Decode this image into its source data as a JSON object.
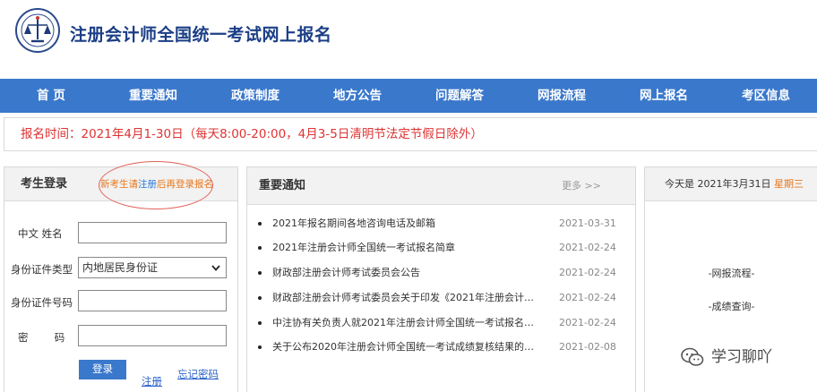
{
  "header": {
    "title": "注册会计师全国统一考试网上报名"
  },
  "nav": {
    "items": [
      "首 页",
      "重要通知",
      "政策制度",
      "地方公告",
      "问题解答",
      "网报流程",
      "网上报名",
      "考区信息"
    ]
  },
  "notice_bar": {
    "text": "报名时间：2021年4月1-30日（每天8:00-20:00，4月3-5日清明节法定节假日除外）"
  },
  "login": {
    "title": "考生登录",
    "hint_prefix": "新考生请",
    "hint_link": "注册",
    "hint_suffix": "后再登录报名",
    "labels": {
      "name": "中文  姓名",
      "id_type": "身份证件类型",
      "id_number": "身份证件号码",
      "password": "密        码"
    },
    "name_value": "",
    "id_type_value": "内地居民身份证",
    "id_number_value": "",
    "password_value": "",
    "login_button": "登录",
    "register_link": "注册",
    "forgot_link": "忘记密码"
  },
  "notices": {
    "title": "重要通知",
    "more": "更多 >>",
    "items": [
      {
        "title": "2021年报名期间各地咨询电话及邮箱",
        "date": "2021-03-31"
      },
      {
        "title": "2021年注册会计师全国统一考试报名简章",
        "date": "2021-02-24"
      },
      {
        "title": "财政部注册会计师考试委员会公告",
        "date": "2021-02-24"
      },
      {
        "title": "财政部注册会计师考试委员会关于印发《2021年注册会计师...",
        "date": "2021-02-24"
      },
      {
        "title": "中注协有关负责人就2021年注册会计师全国统一考试报名相...",
        "date": "2021-02-24"
      },
      {
        "title": "关于公布2020年注册会计师全国统一考试成绩复核结果的公...",
        "date": "2021-02-08"
      }
    ]
  },
  "right": {
    "today_prefix": "今天是 2021年3月31日 ",
    "weekday": "星期三",
    "links": [
      "-网报流程-",
      "-成绩查询-"
    ]
  },
  "watermark": {
    "text": "学习聊吖"
  },
  "colors": {
    "nav_bg": "#3a78cc",
    "title": "#1b3e86",
    "notice_red": "#d33333",
    "accent_orange": "#e8761a"
  }
}
